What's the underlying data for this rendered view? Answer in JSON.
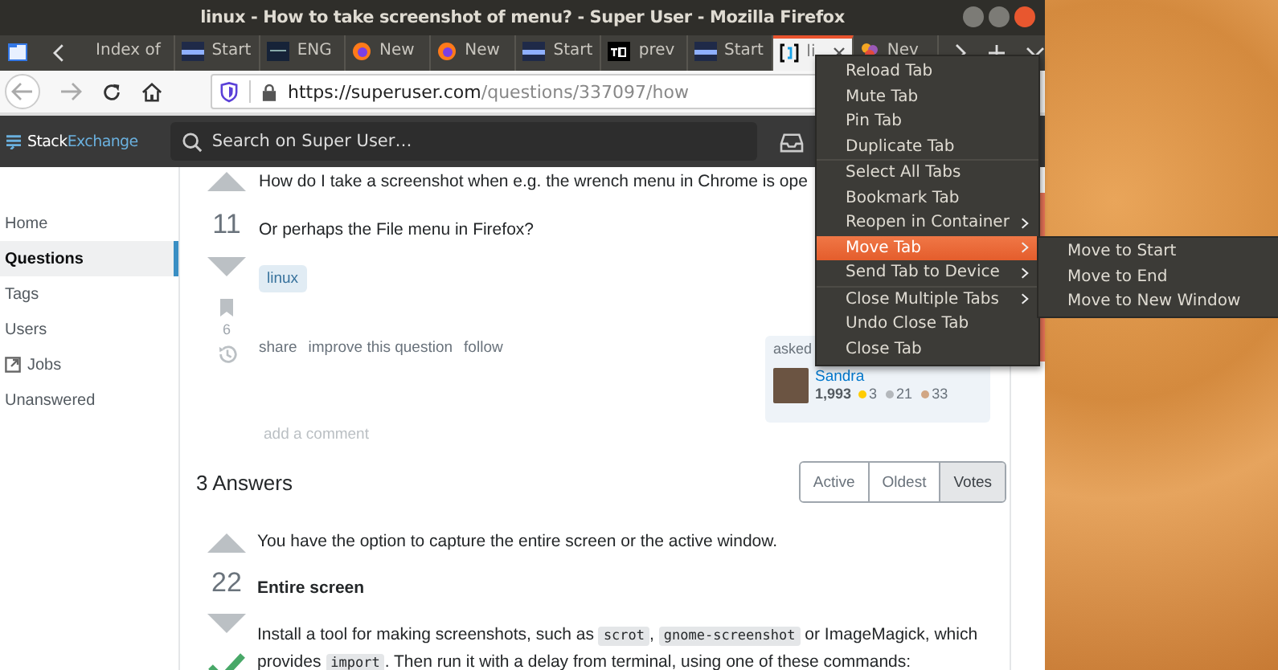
{
  "window": {
    "title": "linux - How to take screenshot of menu? - Super User - Mozilla Firefox"
  },
  "tabs": [
    {
      "kind": "folder",
      "selected": false
    },
    {
      "kind": "plain",
      "label": "Index of",
      "selected": false
    },
    {
      "kind": "start",
      "label": "Start",
      "selected": false
    },
    {
      "kind": "dark",
      "label": "ENG",
      "selected": false
    },
    {
      "kind": "firefox",
      "label": "New",
      "selected": false
    },
    {
      "kind": "firefox",
      "label": "New",
      "selected": false
    },
    {
      "kind": "start",
      "label": "Start",
      "selected": false
    },
    {
      "kind": "td",
      "label": "prev",
      "selected": false
    },
    {
      "kind": "start",
      "label": "Start",
      "selected": false
    },
    {
      "kind": "bracket",
      "label": "li",
      "selected": true
    },
    {
      "kind": "colorful",
      "label": "Nev",
      "selected": false
    }
  ],
  "address_bar": {
    "url_host": "https://superuser.com",
    "url_path": "/questions/337097/how"
  },
  "site_header": {
    "logo_left": "Stack",
    "logo_right": "Exchange",
    "search": {
      "placeholder": "Search on Super User…"
    }
  },
  "sidebar": {
    "items": [
      {
        "label": "Home",
        "selected": false,
        "kind": "text"
      },
      {
        "label": "Questions",
        "selected": true,
        "kind": "text"
      },
      {
        "label": "Tags",
        "selected": false,
        "kind": "text"
      },
      {
        "label": "Users",
        "selected": false,
        "kind": "text"
      },
      {
        "label": "Jobs",
        "selected": false,
        "kind": "external"
      },
      {
        "label": "Unanswered",
        "selected": false,
        "kind": "text"
      }
    ]
  },
  "question": {
    "votes": "11",
    "bookmarks": "6",
    "body": [
      "How do I take a screenshot when e.g. the wrench menu in Chrome is ope",
      "Or perhaps the File menu in Firefox?"
    ],
    "tags": [
      "linux"
    ],
    "links": [
      "share",
      "improve this question",
      "follow"
    ],
    "asked": {
      "label": "asked",
      "user": "Sandra",
      "reputation": "1,993",
      "badges": [
        {
          "count": "3",
          "color": "#ffcc01"
        },
        {
          "count": "21",
          "color": "#b4b8bc"
        },
        {
          "count": "33",
          "color": "#d1a684"
        }
      ]
    },
    "comment_link": "add a comment"
  },
  "answers": {
    "heading": "3 Answers",
    "sort": [
      {
        "label": "Active",
        "selected": false
      },
      {
        "label": "Oldest",
        "selected": false
      },
      {
        "label": "Votes",
        "selected": true
      }
    ],
    "items": [
      {
        "votes": "22",
        "accepted": true,
        "blocks": [
          {
            "kind": "para",
            "parts": [
              {
                "text": "You have the option to capture the entire screen or the active window.",
                "code": false
              }
            ]
          },
          {
            "kind": "heading",
            "parts": [
              {
                "text": "Entire screen",
                "code": false
              }
            ]
          },
          {
            "kind": "para",
            "parts": [
              {
                "text": "Install a tool for making screenshots, such as ",
                "code": false
              },
              {
                "text": "scrot",
                "code": true
              },
              {
                "text": ", ",
                "code": false
              },
              {
                "text": "gnome-screenshot",
                "code": true
              },
              {
                "text": " or ImageMagick, which provides ",
                "code": false
              },
              {
                "text": "import",
                "code": true
              },
              {
                "text": ". Then run it with a delay from terminal, using one of these commands:",
                "code": false
              }
            ]
          }
        ]
      }
    ]
  },
  "context_menu": {
    "items": [
      {
        "kind": "item",
        "label": "Reload Tab",
        "submenu": false,
        "selected": false
      },
      {
        "kind": "item",
        "label": "Mute Tab",
        "submenu": false,
        "selected": false
      },
      {
        "kind": "item",
        "label": "Pin Tab",
        "submenu": false,
        "selected": false
      },
      {
        "kind": "item",
        "label": "Duplicate Tab",
        "submenu": false,
        "selected": false
      },
      {
        "kind": "separator"
      },
      {
        "kind": "item",
        "label": "Select All Tabs",
        "submenu": false,
        "selected": false
      },
      {
        "kind": "item",
        "label": "Bookmark Tab",
        "submenu": false,
        "selected": false
      },
      {
        "kind": "item",
        "label": "Reopen in Container",
        "submenu": true,
        "selected": false
      },
      {
        "kind": "item",
        "label": "Move Tab",
        "submenu": true,
        "selected": true
      },
      {
        "kind": "item",
        "label": "Send Tab to Device",
        "submenu": true,
        "selected": false
      },
      {
        "kind": "separator"
      },
      {
        "kind": "item",
        "label": "Close Multiple Tabs",
        "submenu": true,
        "selected": false
      },
      {
        "kind": "item",
        "label": "Undo Close Tab",
        "submenu": false,
        "selected": false
      },
      {
        "kind": "item",
        "label": "Close Tab",
        "submenu": false,
        "selected": false
      }
    ]
  },
  "submenu": {
    "items": [
      {
        "label": "Move to Start"
      },
      {
        "label": "Move to End"
      },
      {
        "label": "Move to New Window"
      }
    ]
  }
}
